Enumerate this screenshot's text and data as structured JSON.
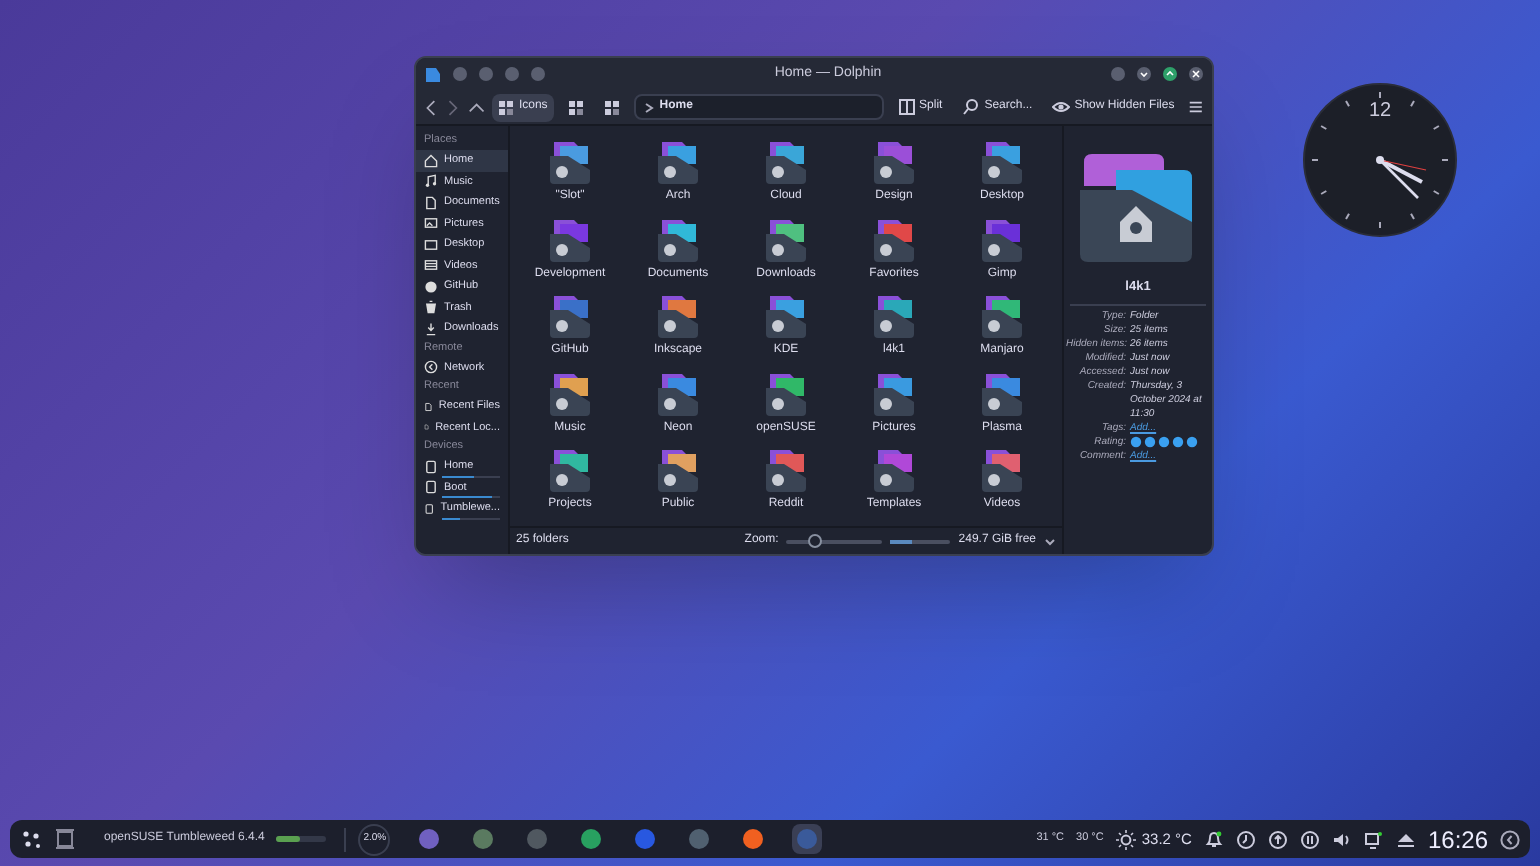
{
  "window": {
    "title": "Home — Dolphin"
  },
  "toolbar": {
    "view_modes": [
      {
        "label": "Icons",
        "selected": true
      },
      {
        "selected": false
      },
      {
        "selected": false
      }
    ],
    "breadcrumb": "Home",
    "actions": [
      "Split",
      "Search...",
      "Show Hidden Files"
    ]
  },
  "sidebar": {
    "sections": [
      {
        "title": "Places",
        "items": [
          {
            "label": "Home",
            "kind": "home",
            "selected": true
          },
          {
            "label": "Music",
            "kind": "music",
            "selected": false
          },
          {
            "label": "Documents",
            "kind": "doc",
            "selected": false
          },
          {
            "label": "Pictures",
            "kind": "pic",
            "selected": false
          },
          {
            "label": "Desktop",
            "kind": "desk",
            "selected": false
          },
          {
            "label": "Videos",
            "kind": "video",
            "selected": false
          },
          {
            "label": "GitHub",
            "kind": "git",
            "selected": false
          },
          {
            "label": "Trash",
            "kind": "trash",
            "selected": false
          },
          {
            "label": "Downloads",
            "kind": "down",
            "selected": false
          }
        ]
      },
      {
        "title": "Remote",
        "items": [
          {
            "label": "Network",
            "kind": "net",
            "selected": false
          }
        ]
      },
      {
        "title": "Recent",
        "items": [
          {
            "label": "Recent Files",
            "kind": "doc",
            "selected": false
          },
          {
            "label": "Recent Loc...",
            "kind": "doc",
            "selected": false
          }
        ]
      },
      {
        "title": "Devices",
        "items": [
          {
            "label": "Home",
            "kind": "drive",
            "selected": false,
            "level": 0.55
          },
          {
            "label": "Boot",
            "kind": "drive",
            "selected": false,
            "level": 0.85
          },
          {
            "label": "Tumblewe...",
            "kind": "drive",
            "selected": false,
            "level": 0.3
          }
        ]
      }
    ]
  },
  "folders": [
    {
      "name": "\"Slot\"",
      "color": "#4a9be0"
    },
    {
      "name": "Arch",
      "color": "#3aa0e0"
    },
    {
      "name": "Cloud",
      "color": "#3aa6d8"
    },
    {
      "name": "Design",
      "color": "#9b4fd8"
    },
    {
      "name": "Desktop",
      "color": "#3aa0e0"
    },
    {
      "name": "Development",
      "color": "#7a38e0"
    },
    {
      "name": "Documents",
      "color": "#30b8d8"
    },
    {
      "name": "Downloads",
      "color": "#4fc080"
    },
    {
      "name": "Favorites",
      "color": "#e04848"
    },
    {
      "name": "Gimp",
      "color": "#6a30d8"
    },
    {
      "name": "GitHub",
      "color": "#3a70c8"
    },
    {
      "name": "Inkscape",
      "color": "#e07840"
    },
    {
      "name": "KDE",
      "color": "#3aa0e0"
    },
    {
      "name": "l4k1",
      "color": "#2aa8b8"
    },
    {
      "name": "Manjaro",
      "color": "#30b878"
    },
    {
      "name": "Music",
      "color": "#e0a050"
    },
    {
      "name": "Neon",
      "color": "#3a8ae0"
    },
    {
      "name": "openSUSE",
      "color": "#30b868"
    },
    {
      "name": "Pictures",
      "color": "#3a9ae0"
    },
    {
      "name": "Plasma",
      "color": "#3a8ae0"
    },
    {
      "name": "Projects",
      "color": "#30b8a0"
    },
    {
      "name": "Public",
      "color": "#e0a060"
    },
    {
      "name": "Reddit",
      "color": "#e05858"
    },
    {
      "name": "Templates",
      "color": "#b048d8"
    },
    {
      "name": "Videos",
      "color": "#e06070"
    }
  ],
  "info_panel": {
    "name": "l4k1",
    "fields": [
      {
        "label": "Type:",
        "value": "Folder",
        "kind": "text"
      },
      {
        "label": "Size:",
        "value": "25 items",
        "kind": "text"
      },
      {
        "label": "Hidden items:",
        "value": "26 items",
        "kind": "text"
      },
      {
        "label": "Modified:",
        "value": "Just now",
        "kind": "text"
      },
      {
        "label": "Accessed:",
        "value": "Just now",
        "kind": "text"
      },
      {
        "label": "Created:",
        "value": "Thursday, 3 October 2024 at 11:30",
        "kind": "text"
      },
      {
        "label": "Tags:",
        "value": "Add...",
        "kind": "link"
      },
      {
        "label": "Rating:",
        "stars": 5,
        "kind": "rating"
      },
      {
        "label": "Comment:",
        "value": "Add...",
        "kind": "link"
      }
    ]
  },
  "status_bar": {
    "count": "25 folders",
    "zoom_label": "Zoom:",
    "zoom": {
      "level": 0.3
    },
    "free_space": {
      "level": 0.35
    },
    "free_text": "249.7 GiB free"
  },
  "clock_widget": {
    "numerals": [
      "12"
    ]
  },
  "taskbar": {
    "task_title": "openSUSE Tumbleweed 6.4.4",
    "task_progress": {
      "level": 0.45
    },
    "cpu": "2.0%",
    "apps": [
      {
        "color": "#7060c0",
        "active": false
      },
      {
        "color": "#5a7a60",
        "active": false
      },
      {
        "color": "#505860",
        "active": false
      },
      {
        "color": "#28a060",
        "active": false
      },
      {
        "color": "#2858e0",
        "active": false
      },
      {
        "color": "#506070",
        "active": false
      },
      {
        "color": "#f06020",
        "active": false
      },
      {
        "color": "#3a5a9a",
        "active": true
      }
    ],
    "temps": [
      "31 °C",
      "30 °C"
    ],
    "weather": "33.2 °C",
    "time": "16:26"
  }
}
